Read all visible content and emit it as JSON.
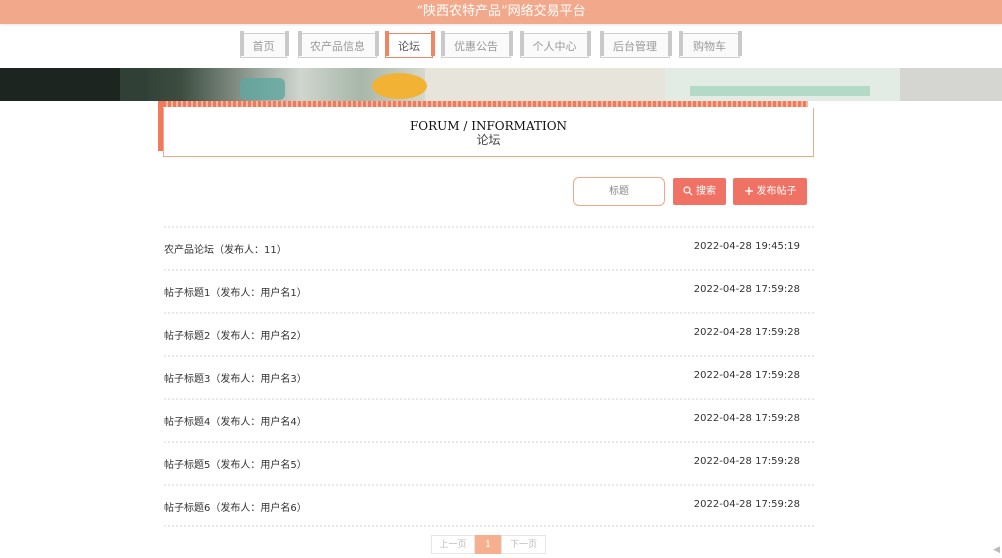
{
  "header": {
    "title": "“陕西农特产品”网络交易平台"
  },
  "nav": {
    "items": [
      {
        "label": "首页"
      },
      {
        "label": "农产品信息"
      },
      {
        "label": "论坛"
      },
      {
        "label": "优惠公告"
      },
      {
        "label": "个人中心"
      },
      {
        "label": "后台管理"
      },
      {
        "label": "购物车"
      }
    ],
    "active_index": 2
  },
  "section": {
    "title_en": "FORUM / INFORMATION",
    "title_cn": "论坛"
  },
  "search": {
    "placeholder": "标题",
    "search_label": "搜索",
    "post_label": "发布帖子"
  },
  "posts": [
    {
      "title": "农产品论坛（发布人：11）",
      "date": "2022-04-28 19:45:19"
    },
    {
      "title": "帖子标题1（发布人：用户名1）",
      "date": "2022-04-28 17:59:28"
    },
    {
      "title": "帖子标题2（发布人：用户名2）",
      "date": "2022-04-28 17:59:28"
    },
    {
      "title": "帖子标题3（发布人：用户名3）",
      "date": "2022-04-28 17:59:28"
    },
    {
      "title": "帖子标题4（发布人：用户名4）",
      "date": "2022-04-28 17:59:28"
    },
    {
      "title": "帖子标题5（发布人：用户名5）",
      "date": "2022-04-28 17:59:28"
    },
    {
      "title": "帖子标题6（发布人：用户名6）",
      "date": "2022-04-28 17:59:28"
    }
  ],
  "pagination": {
    "prev": "上一页",
    "current": "1",
    "next": "下一页"
  },
  "colors": {
    "accent": "#f07264",
    "header_bg": "#f2a88a"
  }
}
